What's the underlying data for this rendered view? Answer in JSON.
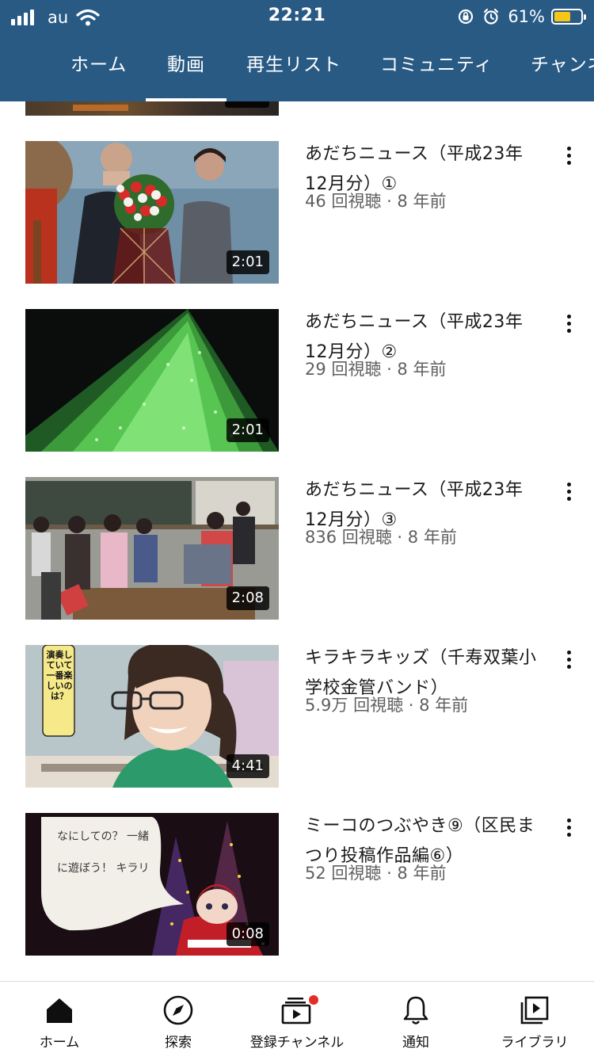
{
  "status_bar": {
    "carrier": "au",
    "time": "22:21",
    "battery_percent": "61%",
    "battery_level": 0.61,
    "battery_color": "#f5c518",
    "icons": [
      "signal-icon",
      "wifi-icon",
      "orientation-lock-icon",
      "alarm-icon",
      "battery-icon"
    ]
  },
  "header": {
    "background_color": "#285a84",
    "tabs": [
      {
        "label": "ホーム"
      },
      {
        "label": "動画"
      },
      {
        "label": "再生リスト"
      },
      {
        "label": "コミュニティ"
      },
      {
        "label": "チャンネル"
      }
    ],
    "active_tab": "動画"
  },
  "videos": [
    {
      "title": "あだちニュース（平成23年12月分）①",
      "views": "46 回視聴 · 8 年前",
      "duration": "2:01",
      "thumbnail": "ceremony-bouquet"
    },
    {
      "title": "あだちニュース（平成23年12月分）②",
      "views": "29 回視聴 · 8 年前",
      "duration": "2:01",
      "thumbnail": "illuminated-tree"
    },
    {
      "title": "あだちニュース（平成23年12月分）③",
      "views": "836 回視聴 · 8 年前",
      "duration": "2:08",
      "thumbnail": "classroom"
    },
    {
      "title": "キラキラキッズ（千寿双葉小学校金管バンド）",
      "views": "5.9万 回視聴 · 8 年前",
      "duration": "4:41",
      "thumbnail": "smiling-girl",
      "caption": "演奏していて 一番楽しいのは？"
    },
    {
      "title": "ミーコのつぶやき⑨（区民まつり投稿作品編⑥）",
      "views": "52 回視聴 · 8 年前",
      "duration": "0:08",
      "thumbnail": "doll-illumination",
      "handwriting": "なにしての？ 一緒に遊ぼう！ キラリ"
    }
  ],
  "bottom_nav": {
    "items": [
      {
        "label": "ホーム",
        "icon": "home-icon"
      },
      {
        "label": "探索",
        "icon": "compass-icon"
      },
      {
        "label": "登録チャンネル",
        "icon": "subscriptions-icon",
        "has_notification": true
      },
      {
        "label": "通知",
        "icon": "bell-icon"
      },
      {
        "label": "ライブラリ",
        "icon": "library-icon"
      }
    ],
    "notification_dot_color": "#e52d27"
  }
}
